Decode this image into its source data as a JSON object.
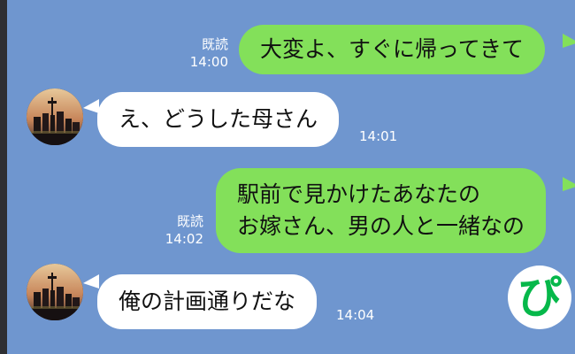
{
  "messages": [
    {
      "direction": "outgoing",
      "read": "既読",
      "time": "14:00",
      "lines": [
        "大変よ、すぐに帰ってきて"
      ]
    },
    {
      "direction": "incoming",
      "time": "14:01",
      "lines": [
        "え、どうした母さん"
      ]
    },
    {
      "direction": "outgoing",
      "read": "既読",
      "time": "14:02",
      "lines": [
        "駅前で見かけたあなたの",
        "お嫁さん、男の人と一緒なの"
      ]
    },
    {
      "direction": "incoming",
      "time": "14:04",
      "lines": [
        "俺の計画通りだな"
      ]
    }
  ],
  "sticker": {
    "glyph": "ぴ"
  },
  "colors": {
    "background": "#6f96cf",
    "outgoing_bubble": "#83e05a",
    "incoming_bubble": "#ffffff",
    "sticker_text": "#06b84a"
  }
}
